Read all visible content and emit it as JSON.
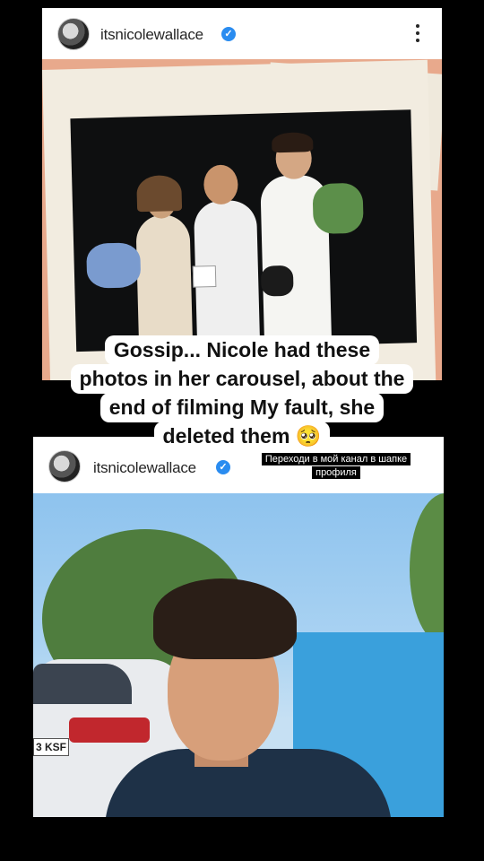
{
  "post1": {
    "username": "itsnicolewallace",
    "verified_icon": "verified-badge-icon",
    "menu_icon": "more-options-icon"
  },
  "caption": {
    "line1": "Gossip... Nicole had these",
    "line2": "photos in her carousel, about the",
    "line3": "end of filming My fault, she",
    "line4": "deleted them 🥺"
  },
  "post2": {
    "username": "itsnicolewallace",
    "verified_icon": "verified-badge-icon"
  },
  "promo": {
    "line1": "Переходи в мой канал в шапке",
    "line2": "профиля"
  },
  "car_plate": "3 KSF",
  "colors": {
    "verified": "#2a8cf0",
    "background": "#000000",
    "sky": "#8ec3ee",
    "container": "#3aa0dc"
  }
}
